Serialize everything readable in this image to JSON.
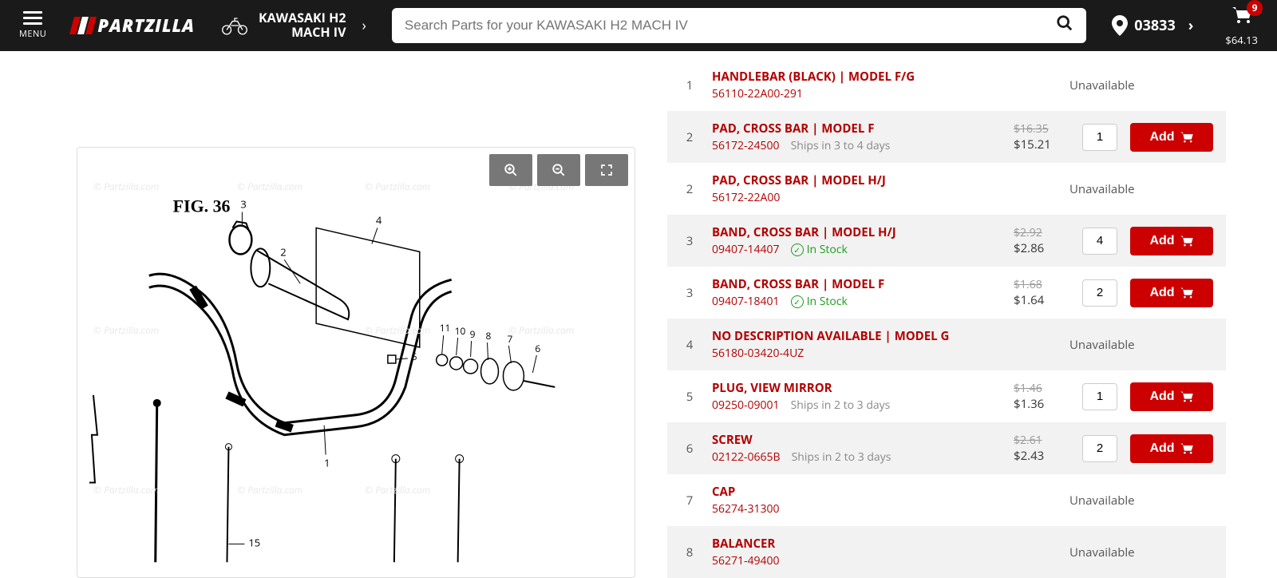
{
  "header": {
    "menu_label": "MENU",
    "logo_text": "PARTZILLA",
    "vehicle_line1": "KAWASAKI H2",
    "vehicle_line2": "MACH IV",
    "search_placeholder": "Search Parts for your KAWASAKI H2 MACH IV",
    "zipcode": "03833",
    "cart_count": "9",
    "cart_total": "$64.13"
  },
  "diagram": {
    "fig_label": "FIG. 36",
    "watermark": "© Partzilla.com"
  },
  "parts": [
    {
      "ref": "1",
      "name": "HANDLEBAR (BLACK) | MODEL F/G",
      "sku": "56110-22A00-291",
      "status": "unavailable",
      "status_text": "Unavailable",
      "alt": false
    },
    {
      "ref": "2",
      "name": "PAD, CROSS BAR | MODEL F",
      "sku": "56172-24500",
      "ship": "Ships in 3 to 4 days",
      "old": "$16.35",
      "new": "$15.21",
      "qty": "1",
      "add": "Add",
      "alt": true
    },
    {
      "ref": "2",
      "name": "PAD, CROSS BAR | MODEL H/J",
      "sku": "56172-22A00",
      "status": "unavailable",
      "status_text": "Unavailable",
      "alt": false
    },
    {
      "ref": "3",
      "name": "BAND, CROSS BAR | MODEL H/J",
      "sku": "09407-14407",
      "stock": "In Stock",
      "old": "$2.92",
      "new": "$2.86",
      "qty": "4",
      "add": "Add",
      "alt": true
    },
    {
      "ref": "3",
      "name": "BAND, CROSS BAR | MODEL F",
      "sku": "09407-18401",
      "stock": "In Stock",
      "old": "$1.68",
      "new": "$1.64",
      "qty": "2",
      "add": "Add",
      "alt": false
    },
    {
      "ref": "4",
      "name": "NO DESCRIPTION AVAILABLE | MODEL G",
      "sku": "56180-03420-4UZ",
      "status": "unavailable",
      "status_text": "Unavailable",
      "alt": true
    },
    {
      "ref": "5",
      "name": "PLUG, VIEW MIRROR",
      "sku": "09250-09001",
      "ship": "Ships in 2 to 3 days",
      "old": "$1.46",
      "new": "$1.36",
      "qty": "1",
      "add": "Add",
      "alt": false
    },
    {
      "ref": "6",
      "name": "SCREW",
      "sku": "02122-0665B",
      "ship": "Ships in 2 to 3 days",
      "old": "$2.61",
      "new": "$2.43",
      "qty": "2",
      "add": "Add",
      "alt": true
    },
    {
      "ref": "7",
      "name": "CAP",
      "sku": "56274-31300",
      "status": "unavailable",
      "status_text": "Unavailable",
      "alt": false
    },
    {
      "ref": "8",
      "name": "BALANCER",
      "sku": "56271-49400",
      "status": "unavailable",
      "status_text": "Unavailable",
      "alt": true
    }
  ]
}
